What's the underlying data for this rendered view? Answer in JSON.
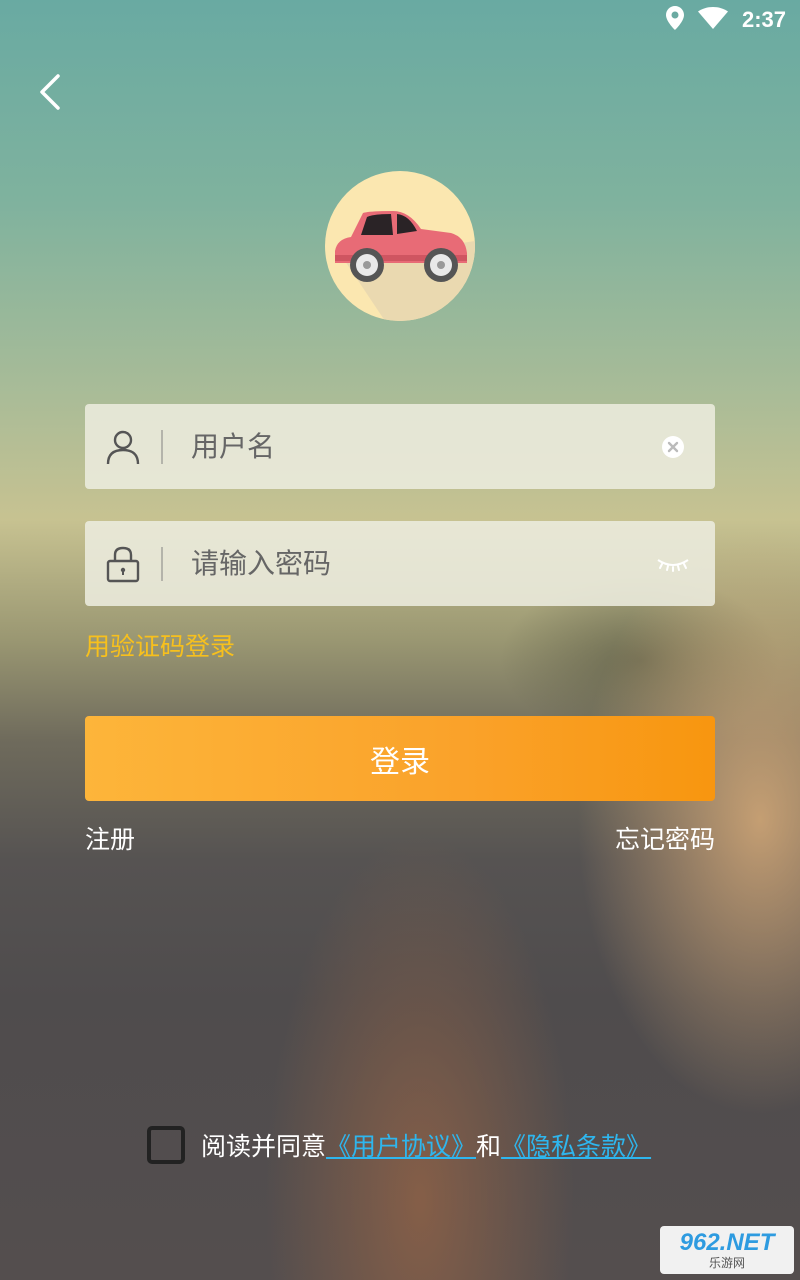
{
  "status_bar": {
    "time": "2:37",
    "icons": [
      "location-icon",
      "wifi-icon"
    ]
  },
  "nav": {
    "back_icon": "chevron-left-icon"
  },
  "avatar": {
    "icon": "car-icon"
  },
  "login_form": {
    "username": {
      "placeholder": "用户名",
      "value": "",
      "lead_icon": "user-icon",
      "trail_icon": "clear-icon"
    },
    "password": {
      "placeholder": "请输入密码",
      "value": "",
      "lead_icon": "lock-icon",
      "trail_icon": "eye-closed-icon"
    },
    "sms_login_label": "用验证码登录",
    "submit_label": "登录",
    "register_label": "注册",
    "forgot_label": "忘记密码"
  },
  "agreement": {
    "checked": false,
    "prefix": "阅读并同意",
    "user_agreement": "《用户协议》",
    "conjunction": "和",
    "privacy_policy": "《隐私条款》"
  },
  "watermark": {
    "brand": "962.NET",
    "sub": "乐游网"
  },
  "colors": {
    "accent": "#faa22a",
    "link_yellow": "#f7c01d",
    "link_blue": "#2eb6ee",
    "avatar_bg": "#fbe7b0"
  }
}
